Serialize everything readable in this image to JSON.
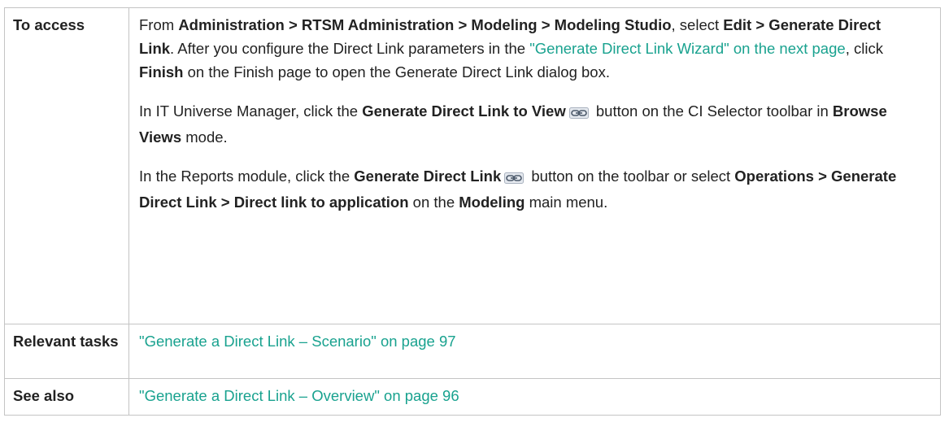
{
  "rows": [
    {
      "label": "To access",
      "p1": {
        "t1": "From ",
        "b1": "Administration > RTSM Administration > Modeling > Modeling Studio",
        "t2": ", select ",
        "b2": "Edit > Generate Direct Link",
        "t3": ". After you configure the Direct Link parameters in the ",
        "link": "\"Generate Direct Link Wizard\" on the next page",
        "t4": ", click ",
        "b3": "Finish",
        "t5": " on the Finish page to open the Generate Direct Link dialog box."
      },
      "p2": {
        "t1": "In IT Universe Manager, click the ",
        "b1": "Generate Direct Link to View",
        "icon": "chain-link-icon",
        "t2": " button on the CI Selector toolbar in ",
        "b2": "Browse Views",
        "t3": " mode."
      },
      "p3": {
        "t1": "In the Reports module, click the ",
        "b1": "Generate Direct Link",
        "icon": "chain-link-icon",
        "t2": " button on the toolbar or select ",
        "b2": "Operations > Generate Direct Link > Direct link to application",
        "t3": " on the ",
        "b3": "Modeling",
        "t4": " main menu."
      }
    },
    {
      "label": "Relevant tasks",
      "link": "\"Generate a Direct Link – Scenario\" on page 97"
    },
    {
      "label": "See also",
      "link": "\"Generate a Direct Link – Overview\" on page 96"
    }
  ],
  "colors": {
    "link": "#19a28f",
    "border": "#c4c4c4",
    "text": "#222222"
  }
}
